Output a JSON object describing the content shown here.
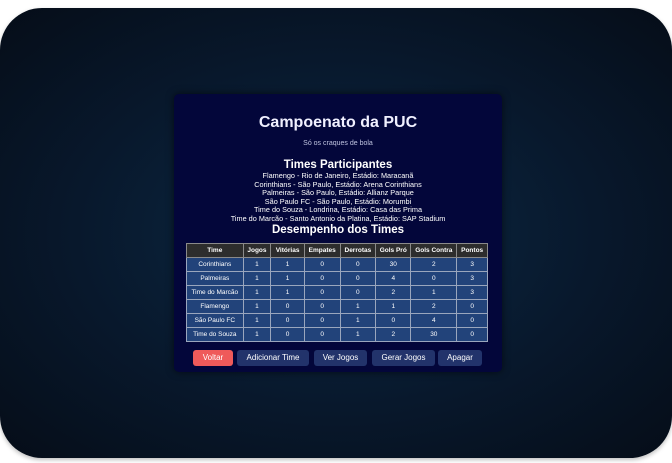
{
  "app": {
    "title": "Campoenato da PUC",
    "subtitle": "Só os craques de bola"
  },
  "teams_section": {
    "heading": "Times Participantes",
    "teams": [
      "Flamengo - Rio de Janeiro, Estádio: Maracanã",
      "Corinthians - São Paulo, Estádio: Arena Corinthians",
      "Palmeiras - São Paulo, Estádio: Allianz Parque",
      "São Paulo FC - São Paulo, Estádio: Morumbi",
      "Time do Souza - Londrina, Estádio: Casa das Prima",
      "Time do Marcão - Santo Antonio da Platina, Estádio: SAP Stadium"
    ]
  },
  "performance": {
    "heading": "Desempenho dos Times",
    "columns": [
      "Time",
      "Jogos",
      "Vitórias",
      "Empates",
      "Derrotas",
      "Gols Pró",
      "Gols Contra",
      "Pontos"
    ],
    "rows": [
      [
        "Corinthians",
        "1",
        "1",
        "0",
        "0",
        "30",
        "2",
        "3"
      ],
      [
        "Palmeiras",
        "1",
        "1",
        "0",
        "0",
        "4",
        "0",
        "3"
      ],
      [
        "Time do Marcão",
        "1",
        "1",
        "0",
        "0",
        "2",
        "1",
        "3"
      ],
      [
        "Flamengo",
        "1",
        "0",
        "0",
        "1",
        "1",
        "2",
        "0"
      ],
      [
        "São Paulo FC",
        "1",
        "0",
        "0",
        "1",
        "0",
        "4",
        "0"
      ],
      [
        "Time do Souza",
        "1",
        "0",
        "0",
        "1",
        "2",
        "30",
        "0"
      ]
    ]
  },
  "actions": {
    "back": "Voltar",
    "add_team": "Adicionar Time",
    "view_games": "Ver Jogos",
    "generate_games": "Gerar Jogos",
    "clear": "Apagar"
  },
  "colors": {
    "card_bg": "#03063a",
    "row_bg": "#22437a",
    "header_bg": "#2d2d2d",
    "button_bg": "#22336b",
    "back_button_bg": "#ef5a5a"
  }
}
